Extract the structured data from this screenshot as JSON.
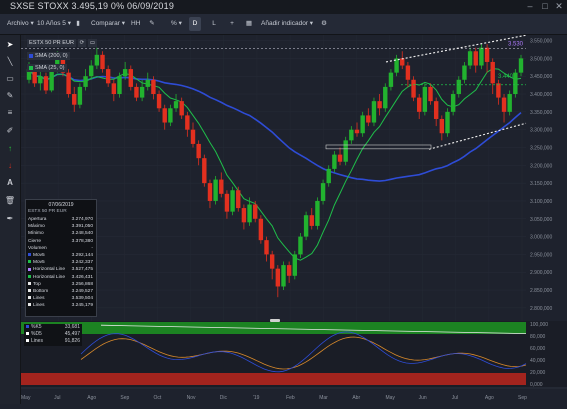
{
  "window": {
    "title": "SXSE STOXX 3.495,19 0% 06/09/2019"
  },
  "toolbar": {
    "file_menu": "Archivo",
    "period_select": "10 Años 5",
    "compare_select": "Comparar",
    "hh_label": "HH",
    "percent_label": "%",
    "d_label": "D",
    "l_label": "L",
    "add_label": "+",
    "add_indicator": "Añadir indicador",
    "settings_label": "⚙"
  },
  "legend": {
    "symbol": "ESTX 50 PR EUR",
    "sma200": "SMA (200, 0)",
    "sma25": "SMA (25, 0)"
  },
  "price_axis": {
    "labels": [
      "3.550,000",
      "3.500,000",
      "3.450,000",
      "3.400,000",
      "3.350,000",
      "3.300,000",
      "3.250,000",
      "3.200,000",
      "3.150,000",
      "3.100,000",
      "3.050,000",
      "3.000,000",
      "2.950,000",
      "2.900,000",
      "2.850,000",
      "2.800,000"
    ]
  },
  "annotations": {
    "level_3530": "3.530",
    "level_3440": "3.440"
  },
  "time_axis": {
    "labels": [
      "May",
      "Jul",
      "Ago",
      "Sep",
      "Oct",
      "Nov",
      "Dic",
      "'19",
      "Feb",
      "Mar",
      "Abr",
      "May",
      "Jun",
      "Jul",
      "Ago",
      "Sep"
    ]
  },
  "data_panel": {
    "date": "07/06/2019",
    "symbol": "ESTX 50 PR EUR",
    "rows": [
      {
        "name": "Apertura",
        "value": "3.274,970",
        "color": ""
      },
      {
        "name": "Máximo",
        "value": "3.391,050",
        "color": ""
      },
      {
        "name": "Mínimo",
        "value": "3.248,540",
        "color": ""
      },
      {
        "name": "Cierre",
        "value": "3.378,380",
        "color": ""
      },
      {
        "name": "Volumen",
        "value": "-",
        "color": ""
      },
      {
        "name": "Mov5",
        "value": "3.292,144",
        "color": "#2e4cd6"
      },
      {
        "name": "Mov5",
        "value": "3.242,337",
        "color": "#1fbf4a"
      },
      {
        "name": "Horizontal Line",
        "value": "3.527,475",
        "color": "#b07cff"
      },
      {
        "name": "Horizontal Line",
        "value": "3.426,431",
        "color": "#1fbf4a"
      },
      {
        "name": "Top",
        "value": "3.256,868",
        "color": "#e8e8e8"
      },
      {
        "name": "Bottom",
        "value": "3.249,527",
        "color": "#e8e8e8"
      },
      {
        "name": "Lines",
        "value": "3.539,504",
        "color": "#e8e8e8"
      },
      {
        "name": "Lines",
        "value": "3.245,179",
        "color": "#e8e8e8"
      }
    ]
  },
  "oscillator": {
    "rows": [
      {
        "name": "%K5",
        "value": "33,681",
        "color": "#2e4cd6"
      },
      {
        "name": "%D5",
        "value": "45,497",
        "color": "#ffffff"
      },
      {
        "name": "Lines",
        "value": "91,826",
        "color": "#ffffff"
      }
    ],
    "axis_labels": [
      "100,000",
      "80,000",
      "60,000",
      "40,000",
      "20,000",
      "0,000"
    ]
  },
  "colors": {
    "up": "#22b22f",
    "down": "#e2301f",
    "sma200": "#2e4cd6",
    "sma25": "#1fbf4a",
    "background": "#1e222d"
  }
}
